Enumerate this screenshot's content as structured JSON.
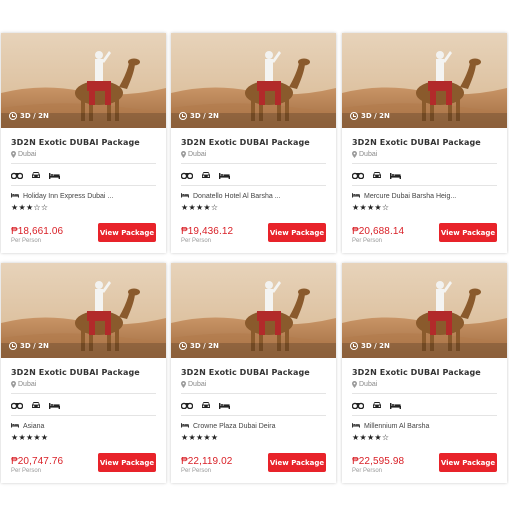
{
  "cards": [
    {
      "duration": "3D / 2N",
      "title": "3D2N Exotic DUBAI Package",
      "location": "Dubai",
      "hotel": "Holiday Inn Express Dubai ...",
      "rating": 3,
      "stars": "★★★☆☆",
      "price": "₱18,661.06",
      "per": "Per Person",
      "button": "View Package"
    },
    {
      "duration": "3D / 2N",
      "title": "3D2N Exotic DUBAI Package",
      "location": "Dubai",
      "hotel": "Donatello Hotel Al Barsha ...",
      "rating": 4,
      "stars": "★★★★☆",
      "price": "₱19,436.12",
      "per": "Per Person",
      "button": "View Package"
    },
    {
      "duration": "3D / 2N",
      "title": "3D2N Exotic DUBAI Package",
      "location": "Dubai",
      "hotel": "Mercure Dubai Barsha Heig...",
      "rating": 4,
      "stars": "★★★★☆",
      "price": "₱20,688.14",
      "per": "Per Person",
      "button": "View Package"
    },
    {
      "duration": "3D / 2N",
      "title": "3D2N Exotic DUBAI Package",
      "location": "Dubai",
      "hotel": "Asiana",
      "rating": 5,
      "stars": "★★★★★",
      "price": "₱20,747.76",
      "per": "Per Person",
      "button": "View Package"
    },
    {
      "duration": "3D / 2N",
      "title": "3D2N Exotic DUBAI Package",
      "location": "Dubai",
      "hotel": "Crowne Plaza Dubai Deira",
      "rating": 5,
      "stars": "★★★★★",
      "price": "₱22,119.02",
      "per": "Per Person",
      "button": "View Package"
    },
    {
      "duration": "3D / 2N",
      "title": "3D2N Exotic DUBAI Package",
      "location": "Dubai",
      "hotel": "Millennium Al Barsha",
      "rating": 4,
      "stars": "★★★★☆",
      "price": "₱22,595.98",
      "per": "Per Person",
      "button": "View Package"
    }
  ],
  "icons": {
    "clock": "clock-icon",
    "pin": "map-pin-icon",
    "amenities": [
      "binoculars-icon",
      "car-icon",
      "bed-icon"
    ],
    "hotel": "bed-icon"
  },
  "colors": {
    "accent": "#e8232a",
    "price": "#d91f26"
  }
}
